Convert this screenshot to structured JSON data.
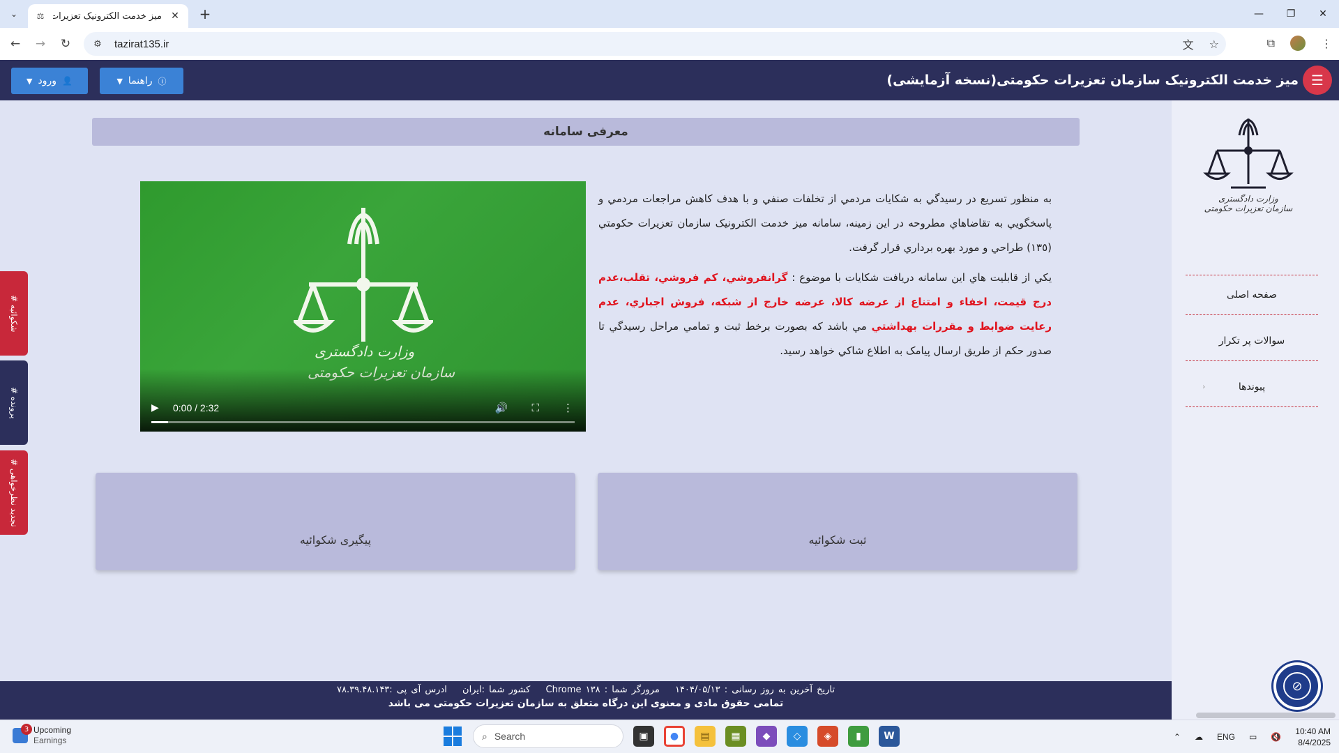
{
  "browser": {
    "tab_title": "میز خدمت الکترونیک تعزیرات حکو",
    "url": "tazirat135.ir"
  },
  "header": {
    "site_title": "میز خدمت الکترونیک سازمان تعزیرات حکومتی(نسخه آزمایشی)",
    "guide_label": "راهنما",
    "login_label": "ورود",
    "colors": {
      "bar": "#2c2f5b",
      "button": "#3b82d6",
      "menu": "#d8374a"
    }
  },
  "sidebar": {
    "logo_caption_1": "وزارت دادگستری",
    "logo_caption_2": "سازمان تعزیرات حکومتی",
    "items": [
      {
        "label": "صفحه اصلی"
      },
      {
        "label": "سوالات پر تکرار"
      },
      {
        "label": "پیوندها"
      }
    ]
  },
  "left_tabs": [
    {
      "label": "# شکوائیه",
      "color": "#c8283a"
    },
    {
      "label": "# پرونده",
      "color": "#2c2f5b"
    },
    {
      "label": "# تجدید نظرخواهی",
      "color": "#c8283a"
    }
  ],
  "main": {
    "section_title": "معرفی سامانه",
    "video": {
      "caption_1": "وزارت دادگستری",
      "caption_2": "سازمان تعزیرات حکومتی",
      "time": "0:00 / 2:32",
      "progress": 0.04
    },
    "intro": {
      "p1": "به منظور تسريع در رسيدگي به شكايات مردمي از تخلفات صنفي و با هدف كاهش مراجعات مردمي و پاسخگويي به تقاضاهاي مطروحه در اين زمينه، سامانه ميز خدمت الكترونيک سازمان تعزيرات حكومتي (١٣٥) طراحي و مورد بهره برداري قرار گرفت.",
      "p2_pre": "يكي از قابليت هاي اين سامانه دريافت شكايات با موضوع : ",
      "p2_highlight": "گرانفروشي، كم فروشي، تقلب،عدم درج قيمت، اخفاء و امتناع از عرضه كالا، عرضه خارج از شبكه، فروش اجباري، عدم رعايت ضوابط و مقررات بهداشتي",
      "p2_post": " مي باشد كه بصورت برخط ثبت و تمامي مراحل رسيدگي تا صدور حكم از طريق ارسال پيامک به اطلاع شاكي خواهد رسيد.",
      "highlight_color": "#e0141e"
    },
    "cards": [
      {
        "label": "ثبت شکوائیه"
      },
      {
        "label": "پیگیری شکوائیه"
      }
    ]
  },
  "footer": {
    "last_update": "تاریخ آخرین به روز رسانی : ۱۴۰۴/۰۵/۱۳",
    "browser_info": "مرورگر شما : Chrome ۱۳۸",
    "country": "کشور شما :ایران",
    "ip": "ادرس آی پی :۷۸.۳۹.۴۸.۱۴۳",
    "copyright": "تمامی حقوق مادی و معنوی این درگاه متعلق به سازمان تعزیرات حکومتی می باشد"
  },
  "taskbar": {
    "widget_badge": "3",
    "widget_title": "Upcoming",
    "widget_sub": "Earnings",
    "search_placeholder": "Search",
    "language": "ENG",
    "time": "10:40 AM",
    "date": "8/4/2025"
  }
}
